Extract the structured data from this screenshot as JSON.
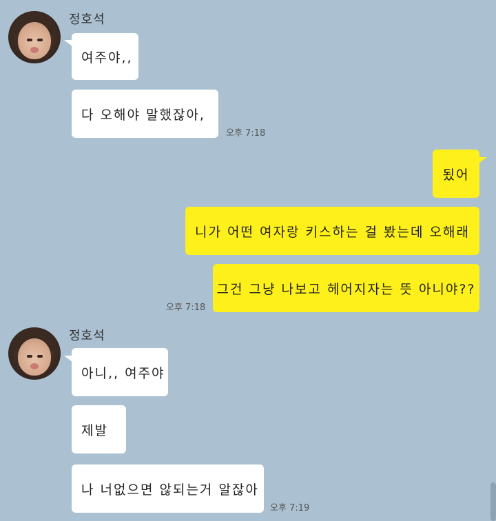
{
  "groups": [
    {
      "sender": "정호석",
      "messages": [
        "여주야,,",
        "다 오해야 말했잖아,"
      ],
      "time": "오후 7:18"
    },
    {
      "messages": [
        "됬어",
        "니가 어떤 여자랑 키스하는 걸 봤는데 오해래",
        "그건 그냥 나보고 헤어지자는 뜻 아니야??"
      ],
      "time": "오후 7:18"
    },
    {
      "sender": "정호석",
      "messages": [
        "아니,, 여주야",
        "제발",
        "나 너없으면 않되는거 알잖아"
      ],
      "time": "오후 7:19"
    }
  ],
  "colors": {
    "background": "#abc1d1",
    "incoming_bubble": "#ffffff",
    "outgoing_bubble": "#fef01b"
  }
}
